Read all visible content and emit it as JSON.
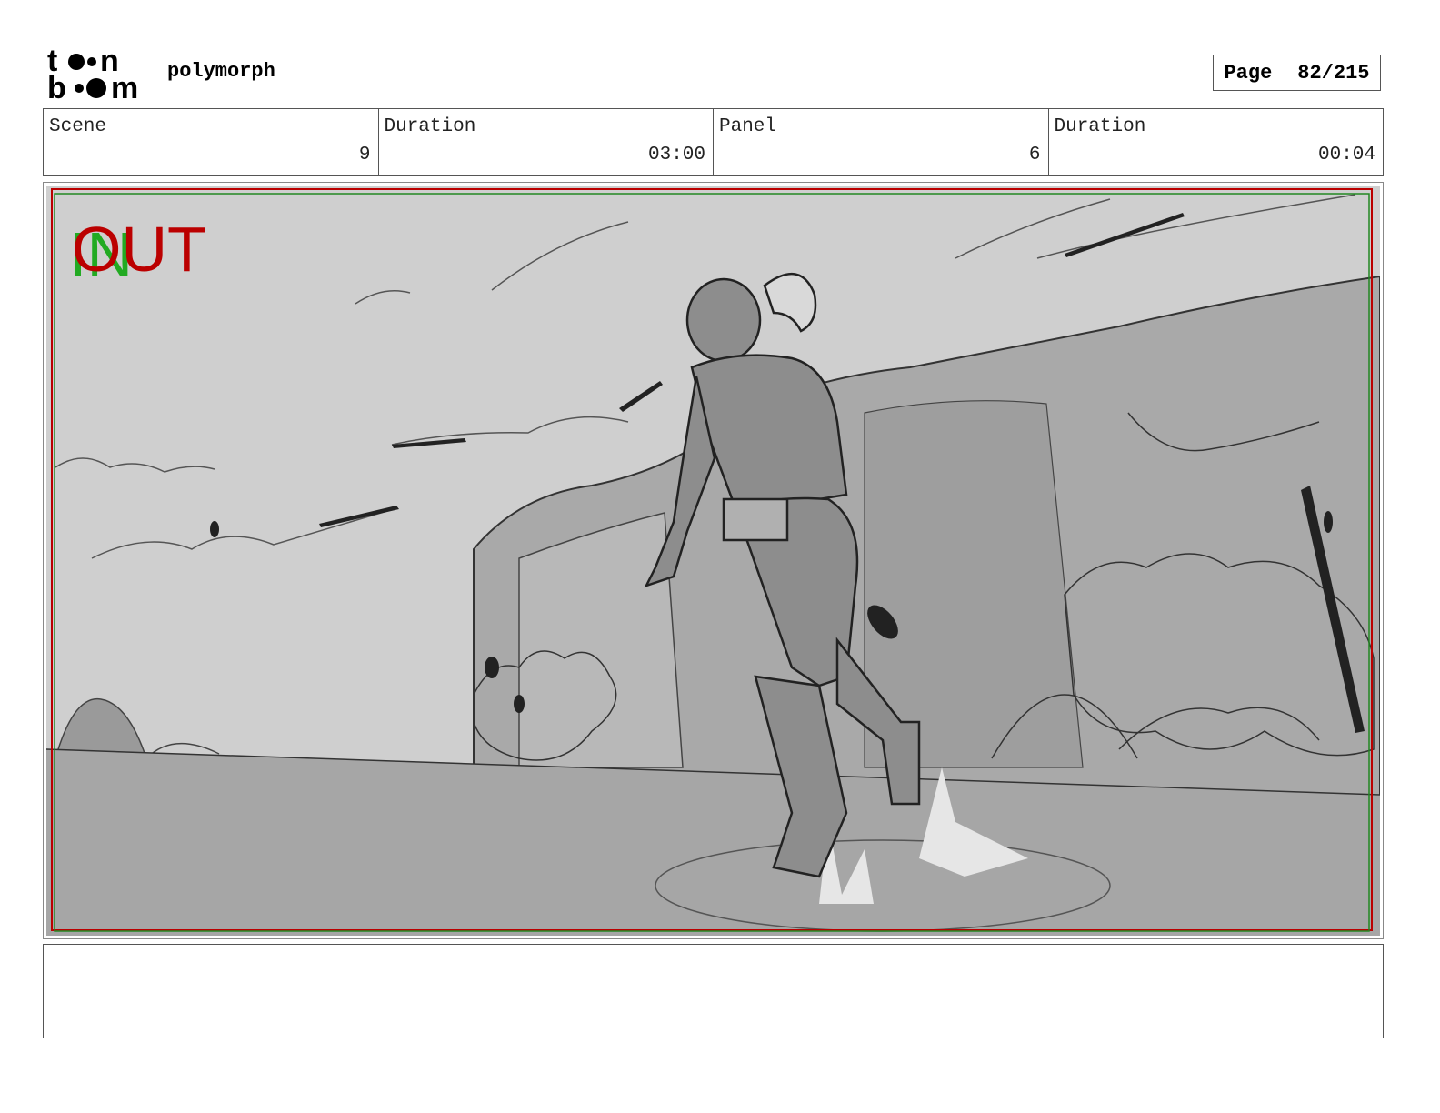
{
  "header": {
    "logo_text_line1": "toon",
    "logo_text_line2": "boom",
    "project_name": "polymorph",
    "page_label": "Page",
    "page_value": "82/215"
  },
  "info": {
    "scene_label": "Scene",
    "scene_value": "9",
    "scene_duration_label": "Duration",
    "scene_duration_value": "03:00",
    "panel_label": "Panel",
    "panel_value": "6",
    "panel_duration_label": "Duration",
    "panel_duration_value": "00:04"
  },
  "panel": {
    "in_label": "IN",
    "out_label": "OUT",
    "in_color": "#22aa22",
    "out_color": "#bb0000",
    "safe_frame_colors": [
      "#bb0000",
      "#228822"
    ]
  },
  "notes": {
    "text": ""
  }
}
